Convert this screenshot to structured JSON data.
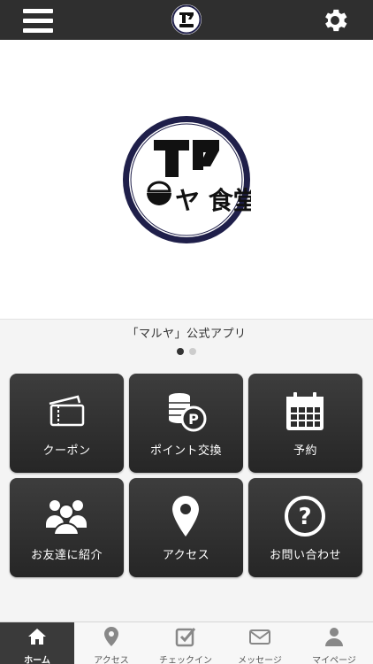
{
  "header": {
    "menu_icon": "hamburger-menu-icon",
    "logo": "maruya-shokudo-logo",
    "settings_icon": "gear-icon"
  },
  "banner": {
    "logo_text": "ヤ 食堂"
  },
  "caption": "「マルヤ」公式アプリ",
  "carousel": {
    "count": 2,
    "active_index": 0,
    "active_color": "#333333",
    "inactive_color": "#cccccc"
  },
  "menu_tiles": [
    {
      "label": "クーポン",
      "icon": "ticket-icon"
    },
    {
      "label": "ポイント交換",
      "icon": "coins-icon"
    },
    {
      "label": "予約",
      "icon": "calendar-icon"
    },
    {
      "label": "お友達に紹介",
      "icon": "group-icon"
    },
    {
      "label": "アクセス",
      "icon": "map-pin-icon"
    },
    {
      "label": "お問い合わせ",
      "icon": "question-icon"
    }
  ],
  "tabbar": [
    {
      "label": "ホーム",
      "icon": "home-icon",
      "active": true
    },
    {
      "label": "アクセス",
      "icon": "map-pin-icon",
      "active": false
    },
    {
      "label": "チェックイン",
      "icon": "checkin-icon",
      "active": false
    },
    {
      "label": "メッセージ",
      "icon": "envelope-icon",
      "active": false
    },
    {
      "label": "マイページ",
      "icon": "person-icon",
      "active": false
    }
  ],
  "colors": {
    "header_bg": "#2f2f2f",
    "tile_bg": "#2d2d2d",
    "logo_ring": "#1f1f4a"
  }
}
